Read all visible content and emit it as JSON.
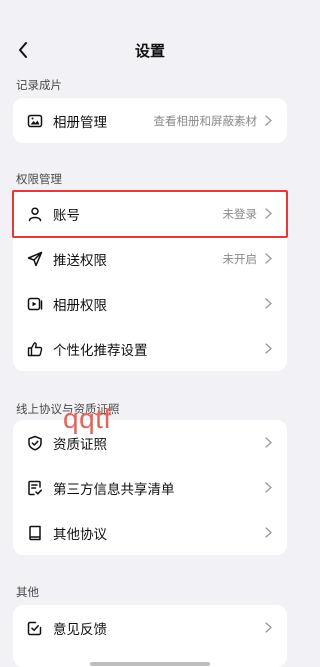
{
  "header": {
    "title": "设置",
    "back_icon": "chevron-left-icon"
  },
  "sections": {
    "records": {
      "label": "记录成片",
      "items": [
        {
          "label": "相册管理",
          "value": "查看相册和屏蔽素材",
          "icon": "photo-icon"
        }
      ]
    },
    "permissions": {
      "label": "权限管理",
      "items": [
        {
          "label": "账号",
          "value": "未登录",
          "icon": "user-icon"
        },
        {
          "label": "推送权限",
          "value": "未开启",
          "icon": "send-icon"
        },
        {
          "label": "相册权限",
          "value": "",
          "icon": "album-icon"
        },
        {
          "label": "个性化推荐设置",
          "value": "",
          "icon": "thumbs-up-icon"
        }
      ]
    },
    "agreements": {
      "label": "线上协议与资质证照",
      "items": [
        {
          "label": "资质证照",
          "value": "",
          "icon": "shield-icon"
        },
        {
          "label": "第三方信息共享清单",
          "value": "",
          "icon": "checklist-icon"
        },
        {
          "label": "其他协议",
          "value": "",
          "icon": "book-icon"
        }
      ]
    },
    "other": {
      "label": "其他",
      "items": [
        {
          "label": "意见反馈",
          "value": "",
          "icon": "feedback-icon"
        }
      ]
    }
  },
  "watermark": "qqtf",
  "colors": {
    "highlight": "#e23a3a",
    "background": "#f2f2f6",
    "watermark": "#e0655b"
  }
}
